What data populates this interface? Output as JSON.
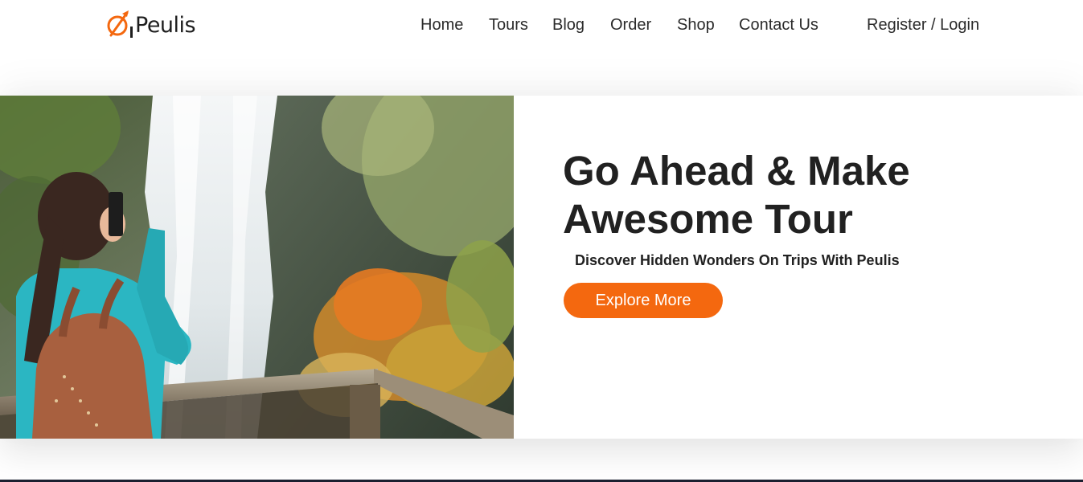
{
  "brand": {
    "name": "Peulis",
    "logo_icon": "compass-plane-icon",
    "accent_color": "#f4680f"
  },
  "nav": {
    "items": [
      {
        "label": "Home"
      },
      {
        "label": "Tours"
      },
      {
        "label": "Blog"
      },
      {
        "label": "Order"
      },
      {
        "label": "Shop"
      },
      {
        "label": "Contact Us"
      }
    ],
    "auth_label": "Register / Login"
  },
  "hero": {
    "image": "woman-photographing-waterfall",
    "title": "Go Ahead & Make Awesome Tour",
    "subtitle": "Discover Hidden Wonders On Trips With Peulis",
    "cta_label": "Explore More"
  }
}
